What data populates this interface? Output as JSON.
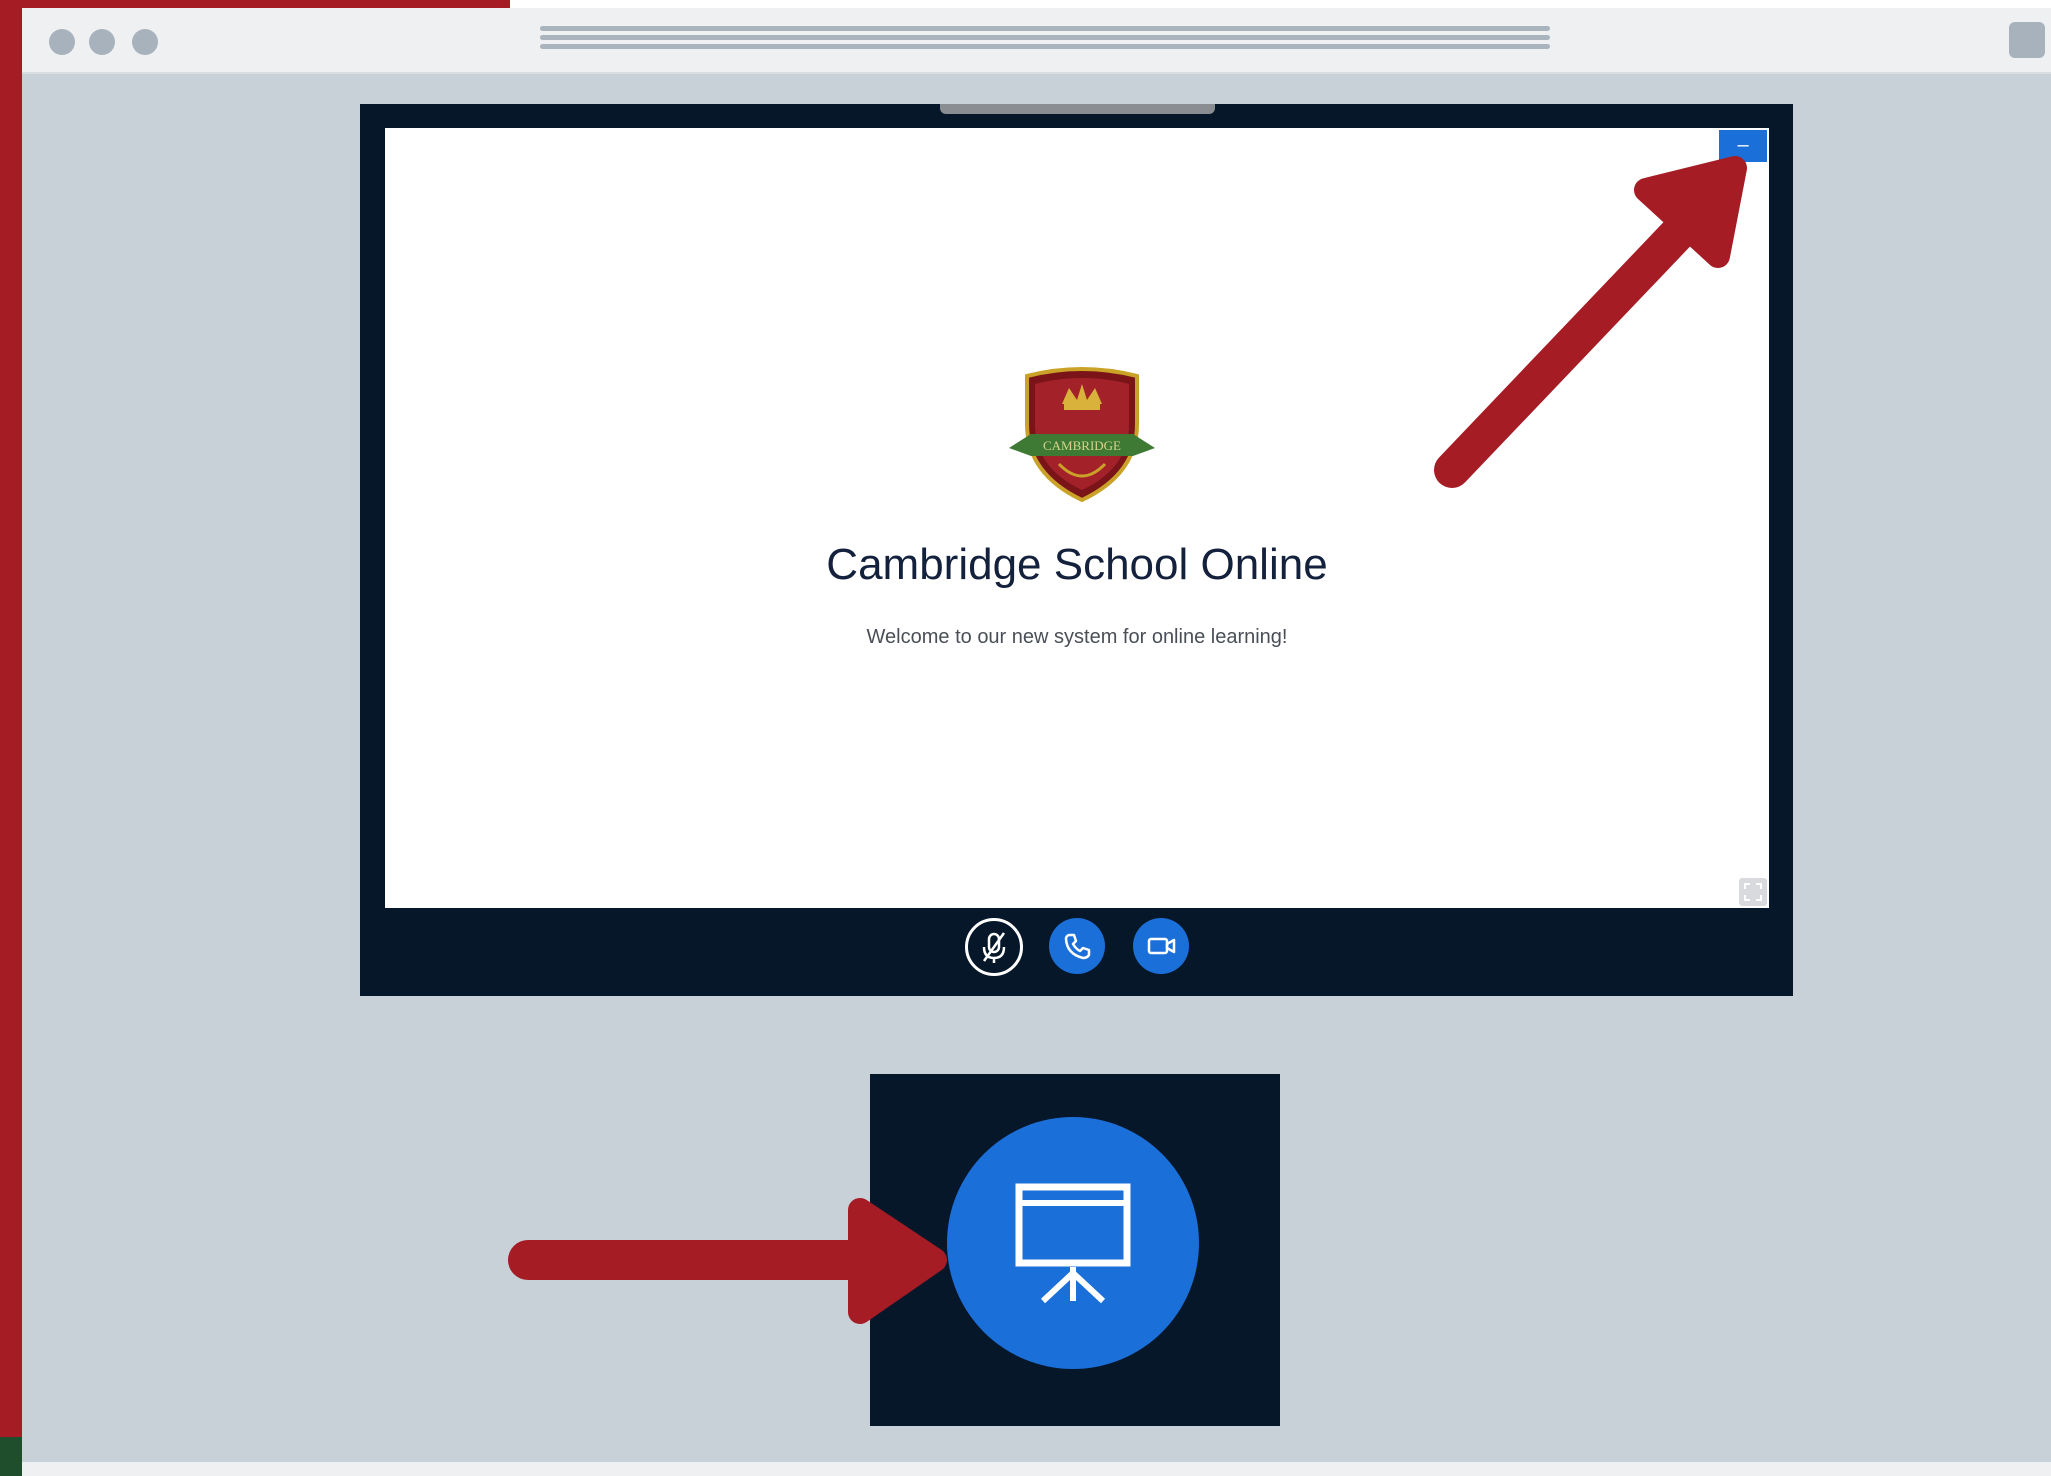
{
  "window": {
    "title_lines": 3,
    "traffic_lights": [
      "close-dot",
      "minimize-dot",
      "zoom-dot"
    ]
  },
  "slide": {
    "title": "Cambridge School Online",
    "subtitle": "Welcome to our new system for online learning!",
    "logo_text": "CAMBRIDGE"
  },
  "minimize": {
    "label": "–"
  },
  "controls": [
    {
      "name": "mute-microphone-button",
      "icon": "muted-microphone-icon"
    },
    {
      "name": "leave-audio-button",
      "icon": "phone-icon"
    },
    {
      "name": "share-webcam-button",
      "icon": "video-camera-icon"
    }
  ],
  "zoomed_button": {
    "icon": "presentation-icon"
  },
  "colors": {
    "accent_red": "#a61c24",
    "button_blue": "#1b6fd8",
    "dark_navy": "#06172a",
    "browser_gray": "#c8d0d8"
  }
}
